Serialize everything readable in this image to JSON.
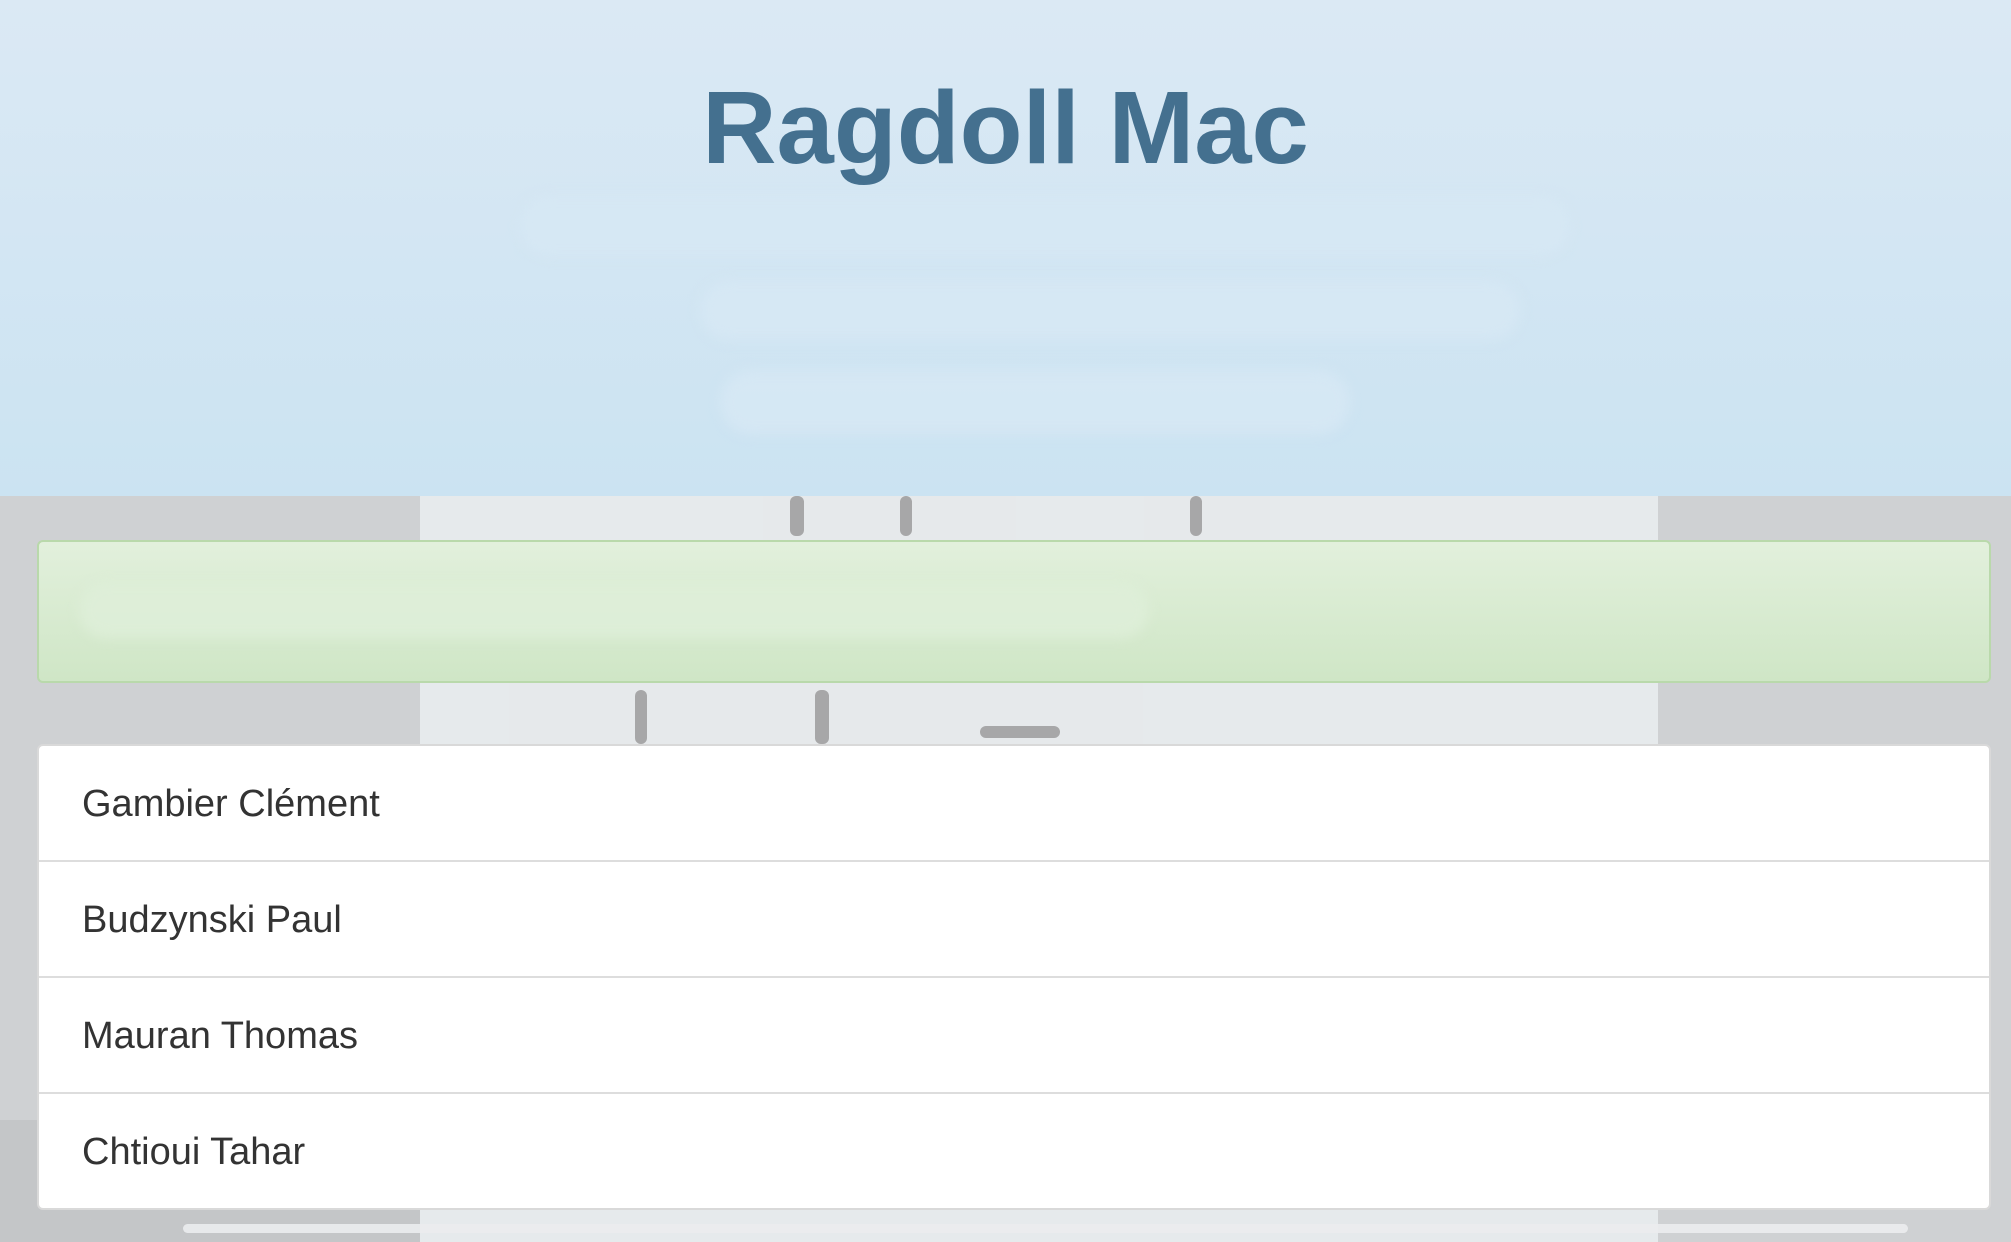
{
  "header": {
    "title": "Ragdoll Mac"
  },
  "members": [
    {
      "name": "Gambier Clément"
    },
    {
      "name": "Budzynski Paul"
    },
    {
      "name": "Mauran Thomas"
    },
    {
      "name": "Chtioui Tahar"
    }
  ],
  "colors": {
    "header_bg": "#d3e6f3",
    "title": "#44708f",
    "alert_bg": "#d8ebd1",
    "alert_border": "#b9d9ab",
    "page_bg": "#cfd1d3"
  }
}
